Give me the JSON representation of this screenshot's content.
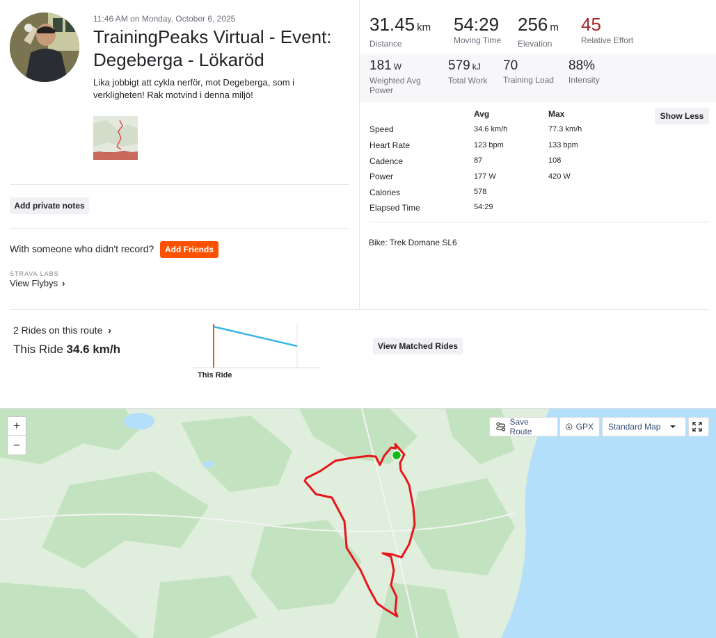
{
  "activity": {
    "timestamp_time": "11:46 AM",
    "timestamp_rest": " on Monday, October 6, 2025",
    "title": "TrainingPeaks Virtual - Event: Degeberga - Lökaröd",
    "description": "Lika jobbigt att cykla nerför, mot Degeberga, som i verkligheten! Rak motvind i denna miljö!"
  },
  "actions": {
    "private_notes": "Add private notes",
    "with_someone": "With someone who didn't record?",
    "add_friends": "Add Friends",
    "labs": "STRAVA LABS",
    "flybys": "View Flybys",
    "flybys_chevron": "›"
  },
  "primary_stats": [
    {
      "value": "31.45",
      "unit": "km",
      "label": "Distance"
    },
    {
      "value": "54:29",
      "unit": "",
      "label": "Moving Time"
    },
    {
      "value": "256",
      "unit": "m",
      "label": "Elevation"
    },
    {
      "value": "45",
      "unit": "",
      "label": "Relative Effort"
    }
  ],
  "secondary_stats": [
    {
      "value": "181",
      "unit": "W",
      "label": "Weighted Avg Power"
    },
    {
      "value": "579",
      "unit": "kJ",
      "label": "Total Work"
    },
    {
      "value": "70",
      "unit": "",
      "label": "Training Load"
    },
    {
      "value": "88%",
      "unit": "",
      "label": "Intensity"
    }
  ],
  "details_table": {
    "col_avg": "Avg",
    "col_max": "Max",
    "rows": [
      {
        "label": "Speed",
        "avg": "34.6 km/h",
        "max": "77.3 km/h"
      },
      {
        "label": "Heart Rate",
        "avg": "123 bpm",
        "max": "133 bpm"
      },
      {
        "label": "Cadence",
        "avg": "87",
        "max": "108"
      },
      {
        "label": "Power",
        "avg": "177 W",
        "max": "420 W"
      },
      {
        "label": "Calories",
        "avg": "578",
        "max": ""
      },
      {
        "label": "Elapsed Time",
        "avg": "54:29",
        "max": ""
      }
    ]
  },
  "show_less": "Show Less",
  "bike": "Bike: Trek Domane SL6",
  "matched": {
    "rides_link": "2 Rides on this route",
    "rides_chevron": "›",
    "this_ride_prefix": "This Ride ",
    "this_ride_value": "34.6 km/h",
    "chart_label": "This Ride",
    "button": "View Matched Rides"
  },
  "map": {
    "zoom_in": "+",
    "zoom_out": "−",
    "save_route": "Save Route",
    "gpx": "GPX",
    "map_type": "Standard Map",
    "route_color": "#e8151a",
    "start_color": "#14b814",
    "water_color": "#b3dffa",
    "land_color": "#dfeedd"
  },
  "colors": {
    "accent": "#fc5200",
    "relative_effort": "#a3272b",
    "link": "#3b4f78"
  }
}
